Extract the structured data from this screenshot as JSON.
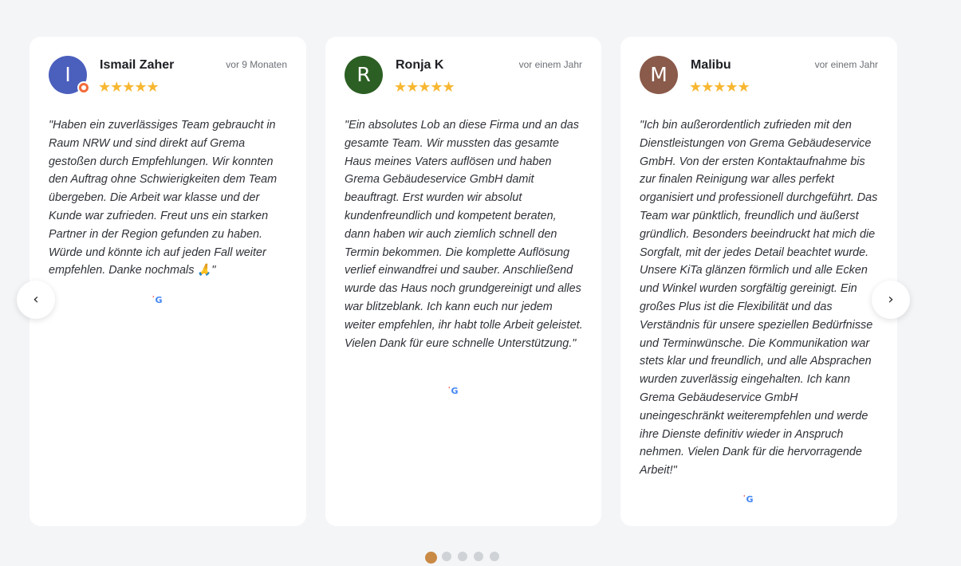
{
  "reviews": [
    {
      "initial": "I",
      "avatar_color": "#4b5fbd",
      "name": "Ismail Zaher",
      "time": "vor 9 Monaten",
      "stars": "★★★★★",
      "text": "\"Haben ein zuverlässiges Team gebraucht in Raum NRW und sind direkt auf Grema gestoßen durch Empfehlungen. Wir konnten den Auftrag ohne Schwierigkeiten dem Team übergeben. Die Arbeit war klasse und der Kunde war zufrieden. Freut uns ein starken Partner in der Region gefunden zu haben. Würde und könnte ich auf jeden Fall weiter empfehlen. Danke nochmals 🙏\"",
      "source_icon": "google-icon"
    },
    {
      "initial": "R",
      "avatar_color": "#2c5f24",
      "name": "Ronja K",
      "time": "vor einem Jahr",
      "stars": "★★★★★",
      "text": "\"Ein absolutes Lob an diese Firma und an das gesamte Team. Wir mussten das gesamte Haus meines Vaters auflösen und haben Grema Gebäudeservice GmbH damit beauftragt. Erst wurden wir absolut kundenfreundlich und kompetent beraten, dann haben wir auch ziemlich schnell den Termin bekommen. Die komplette Auflösung verlief einwandfrei und sauber. Anschließend wurde das Haus noch grundgereinigt und alles war blitzeblank. Ich kann euch nur jedem weiter empfehlen, ihr habt tolle Arbeit geleistet. Vielen Dank für eure schnelle Unterstützung.\"",
      "source_icon": "google-icon"
    },
    {
      "initial": "M",
      "avatar_color": "#8a5a4a",
      "name": "Malibu",
      "time": "vor einem Jahr",
      "stars": "★★★★★",
      "text": "\"Ich bin außerordentlich zufrieden mit den Dienstleistungen von Grema Gebäudeservice GmbH. Von der ersten Kontaktaufnahme bis zur finalen Reinigung war alles perfekt organisiert und professionell durchgeführt. Das Team war pünktlich, freundlich und äußerst gründlich. Besonders beeindruckt hat mich die Sorgfalt, mit der jedes Detail beachtet wurde. Unsere KiTa glänzen förmlich und alle Ecken und Winkel wurden sorgfältig gereinigt. Ein großes Plus ist die Flexibilität und das Verständnis für unsere speziellen Bedürfnisse und Terminwünsche. Die Kommunikation war stets klar und freundlich, und alle Absprachen wurden zuverlässig eingehalten. Ich kann Grema Gebäudeservice GmbH uneingeschränkt weiterempfehlen und werde ihre Dienste definitiv wieder in Anspruch nehmen. Vielen Dank für die hervorragende Arbeit!\"",
      "source_icon": "google-icon"
    }
  ],
  "nav": {
    "prev": "‹",
    "next": "›"
  },
  "source_mark": {
    "tick": "'",
    "letter": "G"
  },
  "pagination": {
    "count": 5,
    "active_index": 0,
    "active_color": "#c98a45"
  }
}
